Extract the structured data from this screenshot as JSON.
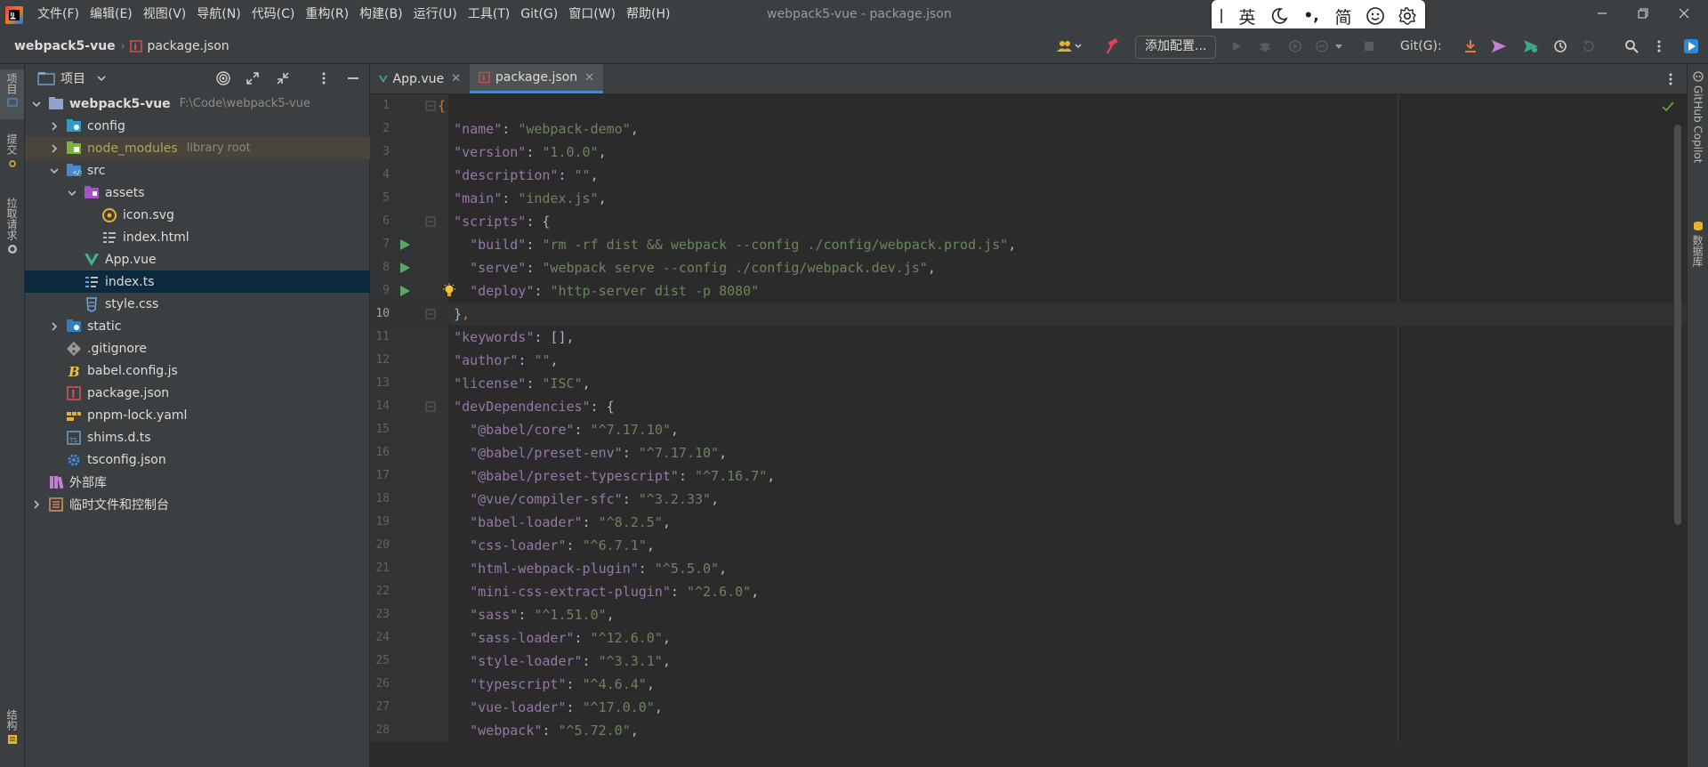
{
  "window": {
    "title": "webpack5-vue - package.json",
    "menu": [
      "文件(F)",
      "编辑(E)",
      "视图(V)",
      "导航(N)",
      "代码(C)",
      "重构(R)",
      "构建(B)",
      "运行(U)",
      "工具(T)",
      "Git(G)",
      "窗口(W)",
      "帮助(H)"
    ],
    "controls": {
      "minimize": "—",
      "restore": "❐",
      "close": "✕"
    }
  },
  "ime": {
    "mode": "英",
    "punct": "•,",
    "script": "简"
  },
  "navbar": {
    "breadcrumb": [
      "webpack5-vue",
      "package.json"
    ],
    "run_config_label": "添加配置...",
    "git_label": "Git(G):"
  },
  "left_strip": {
    "project": "项目",
    "commit": "提交",
    "pull_requests": "拉取请求",
    "structure": "结构"
  },
  "right_strip": {
    "copilot": "GitHub Copilot",
    "database": "数据库"
  },
  "project_panel": {
    "title": "项目",
    "tree": [
      {
        "name": "webpack5-vue",
        "extra": "F:\\Code\\webpack5-vue",
        "icon": "folder-icon",
        "expanded": true
      },
      {
        "name": "config",
        "extra": "",
        "icon": "config-folder-icon",
        "expanded": false
      },
      {
        "name": "node_modules",
        "extra": "library root",
        "icon": "node-modules-icon",
        "expanded": false
      },
      {
        "name": "src",
        "extra": "",
        "icon": "src-folder-icon",
        "expanded": true
      },
      {
        "name": "assets",
        "extra": "",
        "icon": "assets-folder-icon",
        "expanded": true
      },
      {
        "name": "icon.svg",
        "extra": "",
        "icon": "svg-file-icon"
      },
      {
        "name": "index.html",
        "extra": "",
        "icon": "html-file-icon"
      },
      {
        "name": "App.vue",
        "extra": "",
        "icon": "vue-file-icon"
      },
      {
        "name": "index.ts",
        "extra": "",
        "icon": "ts-file-icon"
      },
      {
        "name": "style.css",
        "extra": "",
        "icon": "css-file-icon"
      },
      {
        "name": "static",
        "extra": "",
        "icon": "static-folder-icon",
        "expanded": false
      },
      {
        "name": ".gitignore",
        "extra": "",
        "icon": "gitignore-icon"
      },
      {
        "name": "babel.config.js",
        "extra": "",
        "icon": "babel-file-icon"
      },
      {
        "name": "package.json",
        "extra": "",
        "icon": "npm-file-icon"
      },
      {
        "name": "pnpm-lock.yaml",
        "extra": "",
        "icon": "yaml-file-icon"
      },
      {
        "name": "shims.d.ts",
        "extra": "",
        "icon": "dts-file-icon"
      },
      {
        "name": "tsconfig.json",
        "extra": "",
        "icon": "tsconfig-file-icon"
      },
      {
        "name": "外部库",
        "extra": "",
        "icon": "library-icon"
      },
      {
        "name": "临时文件和控制台",
        "extra": "",
        "icon": "scratches-icon",
        "expanded": false
      }
    ],
    "selected": "index.ts"
  },
  "tabs": [
    {
      "label": "App.vue",
      "active": false
    },
    {
      "label": "package.json",
      "active": true
    }
  ],
  "editor": {
    "lines": [
      {
        "n": "1",
        "tokens": [
          [
            "p",
            "{"
          ]
        ]
      },
      {
        "n": "2",
        "tokens": [
          [
            "t",
            "  "
          ],
          [
            "k",
            "\"name\""
          ],
          [
            "t",
            ": "
          ],
          [
            "s",
            "\"webpack-demo\""
          ],
          [
            "t",
            ","
          ]
        ]
      },
      {
        "n": "3",
        "tokens": [
          [
            "t",
            "  "
          ],
          [
            "k",
            "\"version\""
          ],
          [
            "t",
            ": "
          ],
          [
            "s",
            "\"1.0.0\""
          ],
          [
            "t",
            ","
          ]
        ]
      },
      {
        "n": "4",
        "tokens": [
          [
            "t",
            "  "
          ],
          [
            "k",
            "\"description\""
          ],
          [
            "t",
            ": "
          ],
          [
            "s",
            "\"\""
          ],
          [
            "t",
            ","
          ]
        ]
      },
      {
        "n": "5",
        "tokens": [
          [
            "t",
            "  "
          ],
          [
            "k",
            "\"main\""
          ],
          [
            "t",
            ": "
          ],
          [
            "s",
            "\"index.js\""
          ],
          [
            "t",
            ","
          ]
        ]
      },
      {
        "n": "6",
        "tokens": [
          [
            "t",
            "  "
          ],
          [
            "k",
            "\"scripts\""
          ],
          [
            "t",
            ": {"
          ]
        ]
      },
      {
        "n": "7",
        "tokens": [
          [
            "t",
            "    "
          ],
          [
            "k",
            "\"build\""
          ],
          [
            "t",
            ": "
          ],
          [
            "s",
            "\"rm -rf dist && webpack --config ./config/webpack.prod.js\""
          ],
          [
            "t",
            ","
          ]
        ]
      },
      {
        "n": "8",
        "tokens": [
          [
            "t",
            "    "
          ],
          [
            "k",
            "\"serve\""
          ],
          [
            "t",
            ": "
          ],
          [
            "s",
            "\"webpack serve --config ./config/webpack.dev.js\""
          ],
          [
            "t",
            ","
          ]
        ]
      },
      {
        "n": "9",
        "tokens": [
          [
            "t",
            "    "
          ],
          [
            "k",
            "\"deploy\""
          ],
          [
            "t",
            ": "
          ],
          [
            "s",
            "\"http-server dist -p 8080\""
          ]
        ]
      },
      {
        "n": "10",
        "tokens": [
          [
            "t",
            "  }"
          ],
          [
            "p",
            ","
          ]
        ]
      },
      {
        "n": "11",
        "tokens": [
          [
            "t",
            "  "
          ],
          [
            "k",
            "\"keywords\""
          ],
          [
            "t",
            ": [],"
          ]
        ]
      },
      {
        "n": "12",
        "tokens": [
          [
            "t",
            "  "
          ],
          [
            "k",
            "\"author\""
          ],
          [
            "t",
            ": "
          ],
          [
            "s",
            "\"\""
          ],
          [
            "t",
            ","
          ]
        ]
      },
      {
        "n": "13",
        "tokens": [
          [
            "t",
            "  "
          ],
          [
            "k",
            "\"license\""
          ],
          [
            "t",
            ": "
          ],
          [
            "s",
            "\"ISC\""
          ],
          [
            "t",
            ","
          ]
        ]
      },
      {
        "n": "14",
        "tokens": [
          [
            "t",
            "  "
          ],
          [
            "k",
            "\"devDependencies\""
          ],
          [
            "t",
            ": {"
          ]
        ]
      },
      {
        "n": "15",
        "tokens": [
          [
            "t",
            "    "
          ],
          [
            "k",
            "\"@babel/core\""
          ],
          [
            "t",
            ": "
          ],
          [
            "s",
            "\"^7.17.10\""
          ],
          [
            "t",
            ","
          ]
        ]
      },
      {
        "n": "16",
        "tokens": [
          [
            "t",
            "    "
          ],
          [
            "k",
            "\"@babel/preset-env\""
          ],
          [
            "t",
            ": "
          ],
          [
            "s",
            "\"^7.17.10\""
          ],
          [
            "t",
            ","
          ]
        ]
      },
      {
        "n": "17",
        "tokens": [
          [
            "t",
            "    "
          ],
          [
            "k",
            "\"@babel/preset-typescript\""
          ],
          [
            "t",
            ": "
          ],
          [
            "s",
            "\"^7.16.7\""
          ],
          [
            "t",
            ","
          ]
        ]
      },
      {
        "n": "18",
        "tokens": [
          [
            "t",
            "    "
          ],
          [
            "k",
            "\"@vue/compiler-sfc\""
          ],
          [
            "t",
            ": "
          ],
          [
            "s",
            "\"^3.2.33\""
          ],
          [
            "t",
            ","
          ]
        ]
      },
      {
        "n": "19",
        "tokens": [
          [
            "t",
            "    "
          ],
          [
            "k",
            "\"babel-loader\""
          ],
          [
            "t",
            ": "
          ],
          [
            "s",
            "\"^8.2.5\""
          ],
          [
            "t",
            ","
          ]
        ]
      },
      {
        "n": "20",
        "tokens": [
          [
            "t",
            "    "
          ],
          [
            "k",
            "\"css-loader\""
          ],
          [
            "t",
            ": "
          ],
          [
            "s",
            "\"^6.7.1\""
          ],
          [
            "t",
            ","
          ]
        ]
      },
      {
        "n": "21",
        "tokens": [
          [
            "t",
            "    "
          ],
          [
            "k",
            "\"html-webpack-plugin\""
          ],
          [
            "t",
            ": "
          ],
          [
            "s",
            "\"^5.5.0\""
          ],
          [
            "t",
            ","
          ]
        ]
      },
      {
        "n": "22",
        "tokens": [
          [
            "t",
            "    "
          ],
          [
            "k",
            "\"mini-css-extract-plugin\""
          ],
          [
            "t",
            ": "
          ],
          [
            "s",
            "\"^2.6.0\""
          ],
          [
            "t",
            ","
          ]
        ]
      },
      {
        "n": "23",
        "tokens": [
          [
            "t",
            "    "
          ],
          [
            "k",
            "\"sass\""
          ],
          [
            "t",
            ": "
          ],
          [
            "s",
            "\"^1.51.0\""
          ],
          [
            "t",
            ","
          ]
        ]
      },
      {
        "n": "24",
        "tokens": [
          [
            "t",
            "    "
          ],
          [
            "k",
            "\"sass-loader\""
          ],
          [
            "t",
            ": "
          ],
          [
            "s",
            "\"^12.6.0\""
          ],
          [
            "t",
            ","
          ]
        ]
      },
      {
        "n": "25",
        "tokens": [
          [
            "t",
            "    "
          ],
          [
            "k",
            "\"style-loader\""
          ],
          [
            "t",
            ": "
          ],
          [
            "s",
            "\"^3.3.1\""
          ],
          [
            "t",
            ","
          ]
        ]
      },
      {
        "n": "26",
        "tokens": [
          [
            "t",
            "    "
          ],
          [
            "k",
            "\"typescript\""
          ],
          [
            "t",
            ": "
          ],
          [
            "s",
            "\"^4.6.4\""
          ],
          [
            "t",
            ","
          ]
        ]
      },
      {
        "n": "27",
        "tokens": [
          [
            "t",
            "    "
          ],
          [
            "k",
            "\"vue-loader\""
          ],
          [
            "t",
            ": "
          ],
          [
            "s",
            "\"^17.0.0\""
          ],
          [
            "t",
            ","
          ]
        ]
      },
      {
        "n": "28",
        "tokens": [
          [
            "t",
            "    "
          ],
          [
            "k",
            "\"webpack\""
          ],
          [
            "t",
            ": "
          ],
          [
            "s",
            "\"^5.72.0\""
          ],
          [
            "t",
            ","
          ]
        ]
      }
    ],
    "current_line": "10",
    "run_gutter_lines": [
      "7",
      "8"
    ],
    "bulb_line": "9",
    "fold_lines": [
      "1",
      "6",
      "10",
      "14"
    ]
  },
  "colors": {
    "background": "#2b2b2b",
    "panel": "#3c3f41",
    "json_key": "#9876aa",
    "json_string": "#6a8759",
    "punctuation": "#cc7832",
    "selection": "#0d293e",
    "accent": "#4a88c7"
  }
}
